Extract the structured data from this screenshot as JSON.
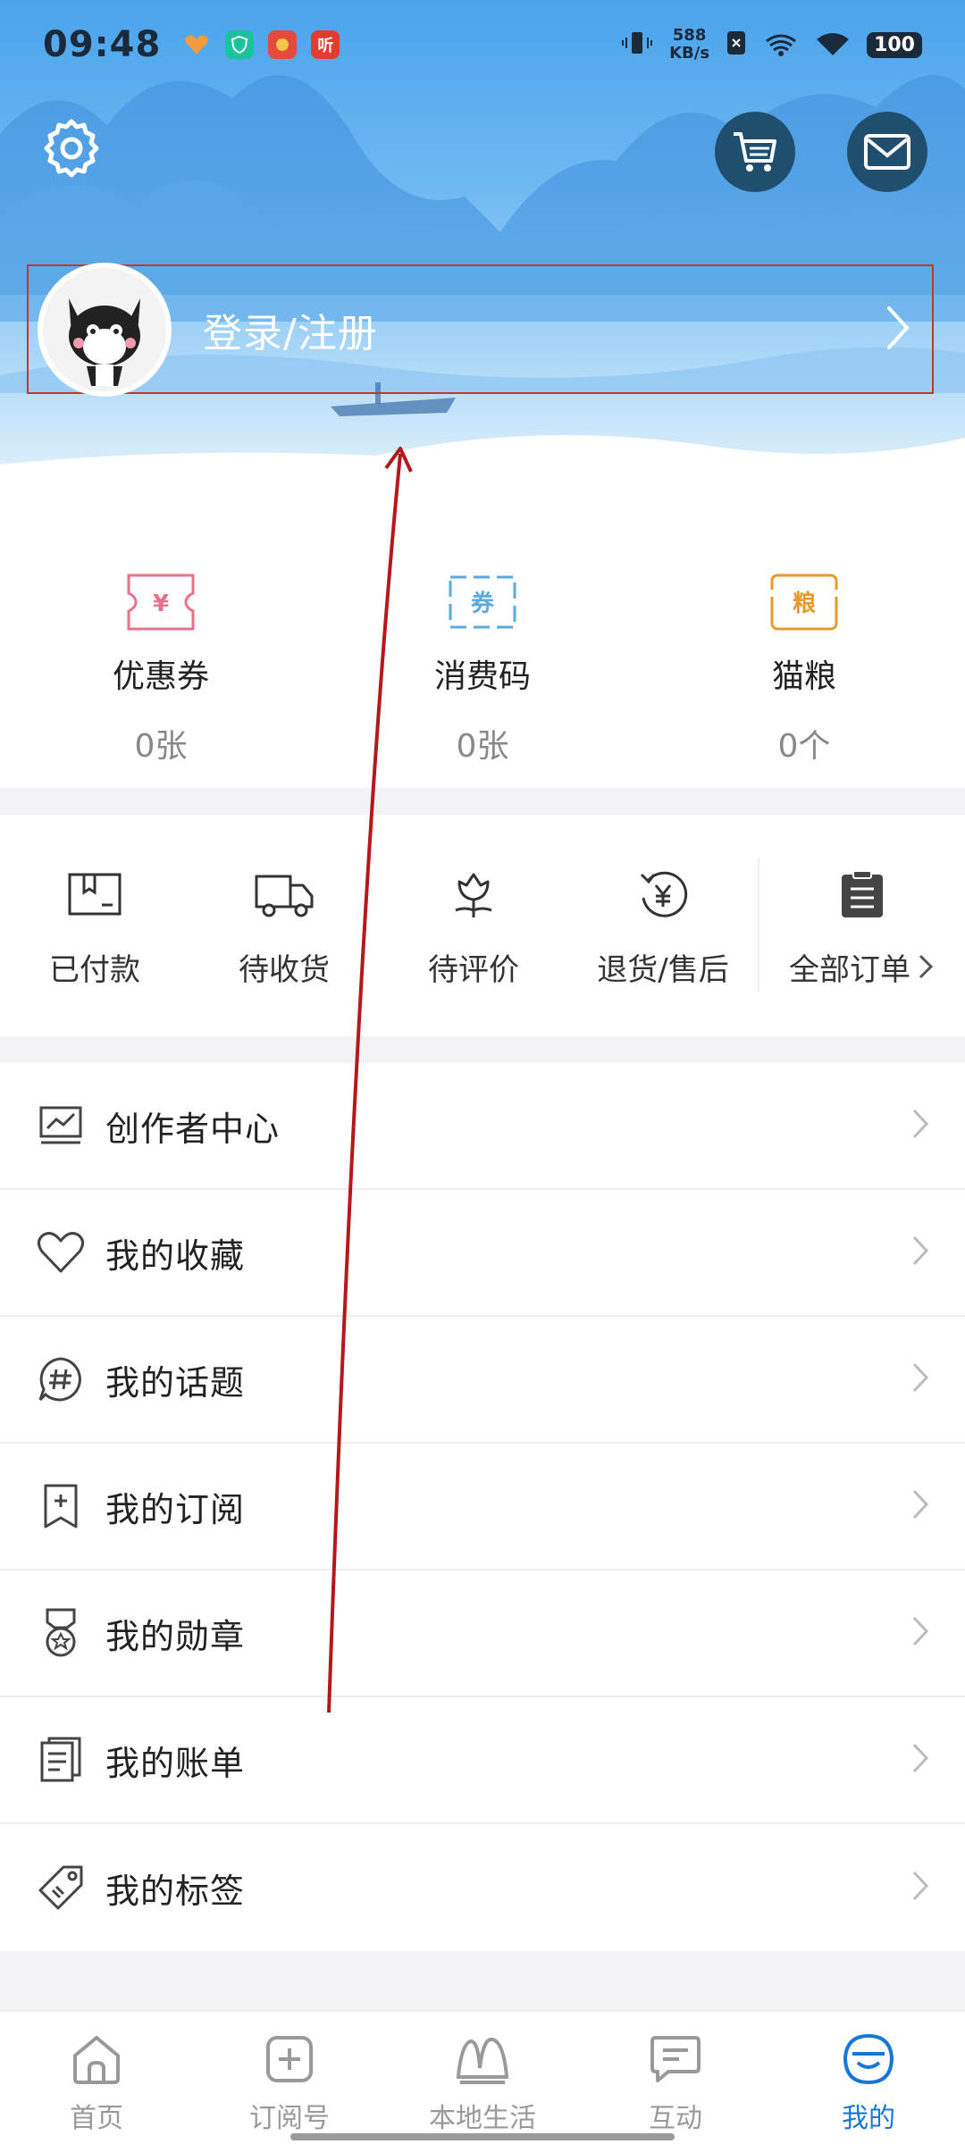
{
  "status_bar": {
    "time": "09:48",
    "speed_value": "588",
    "speed_unit": "KB/s",
    "battery": "100",
    "app_icons": [
      "heart-app-icon",
      "shield-app-icon",
      "game-app-icon",
      "listen-app-icon"
    ],
    "listen_app_glyph": "听"
  },
  "header": {
    "login_text": "登录/注册"
  },
  "stats": [
    {
      "label": "优惠券",
      "value": "0张",
      "icon": "coupon-icon",
      "glyph": "¥",
      "color": "#e8708a"
    },
    {
      "label": "消费码",
      "value": "0张",
      "icon": "voucher-icon",
      "glyph": "券",
      "color": "#5aa9df"
    },
    {
      "label": "猫粮",
      "value": "0个",
      "icon": "cat-food-icon",
      "glyph": "粮",
      "color": "#e69a2b"
    }
  ],
  "orders": {
    "items": [
      {
        "label": "已付款",
        "icon": "paid-box-icon"
      },
      {
        "label": "待收货",
        "icon": "truck-icon"
      },
      {
        "label": "待评价",
        "icon": "flower-review-icon"
      },
      {
        "label": "退货/售后",
        "icon": "refund-icon"
      }
    ],
    "all_label": "全部订单",
    "all_icon": "clipboard-icon"
  },
  "menu": [
    {
      "label": "创作者中心",
      "icon": "chart-icon"
    },
    {
      "label": "我的收藏",
      "icon": "heart-icon"
    },
    {
      "label": "我的话题",
      "icon": "hashtag-chat-icon"
    },
    {
      "label": "我的订阅",
      "icon": "bookmark-plus-icon"
    },
    {
      "label": "我的勋章",
      "icon": "medal-icon"
    },
    {
      "label": "我的账单",
      "icon": "bill-icon"
    },
    {
      "label": "我的标签",
      "icon": "tag-icon"
    }
  ],
  "bottom_nav": [
    {
      "label": "首页",
      "icon": "home-icon",
      "active": false
    },
    {
      "label": "订阅号",
      "icon": "subscribe-icon",
      "active": false
    },
    {
      "label": "本地生活",
      "icon": "local-life-icon",
      "active": false
    },
    {
      "label": "互动",
      "icon": "chat-icon",
      "active": false
    },
    {
      "label": "我的",
      "icon": "me-icon",
      "active": true
    }
  ],
  "colors": {
    "active_blue": "#1677d7",
    "annotation_red": "#b3191c",
    "header_blue": "#4aa3ec"
  }
}
